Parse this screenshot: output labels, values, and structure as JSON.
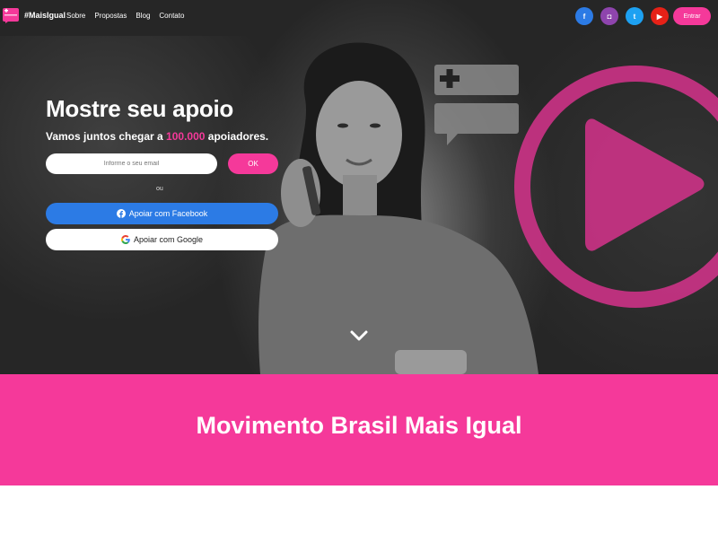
{
  "nav": {
    "brand": "#MaisIgual",
    "links": [
      "Sobre",
      "Propostas",
      "Blog",
      "Contato"
    ],
    "socials": [
      {
        "icon": "facebook-icon",
        "glyph": "f",
        "color": "#2c7be5"
      },
      {
        "icon": "instagram-icon",
        "glyph": "◘",
        "color": "#8e44ad"
      },
      {
        "icon": "twitter-icon",
        "glyph": "t",
        "color": "#1da1f2"
      },
      {
        "icon": "youtube-icon",
        "glyph": "▶",
        "color": "#e62117"
      }
    ],
    "login_label": "Entrar"
  },
  "hero": {
    "title": "Mostre seu apoio",
    "subtitle_pre": "Vamos juntos chegar a ",
    "subtitle_highlight": "100.000",
    "subtitle_post": " apoiadores.",
    "email_placeholder": "Informe o seu email",
    "ok_label": "OK",
    "or_label": "ou",
    "facebook_label": "Apoiar com Facebook",
    "google_label": "Apoiar com Google"
  },
  "band": {
    "title": "Movimento Brasil Mais Igual"
  },
  "colors": {
    "accent": "#f5399a",
    "facebook": "#2c7be5"
  }
}
